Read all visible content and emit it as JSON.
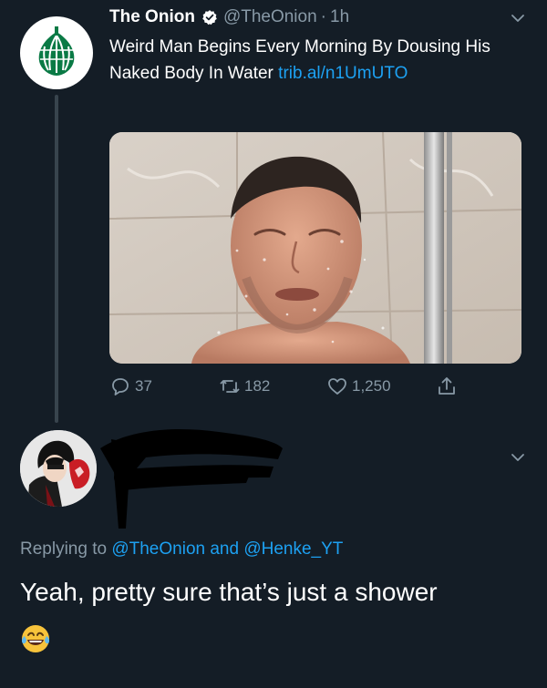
{
  "tweet": {
    "author_name": "The Onion",
    "author_handle": "@TheOnion",
    "separator": "·",
    "time": "1h",
    "text": "Weird Man Begins Every Morning By Dousing His Naked Body In Water ",
    "link": "trib.al/n1UmUTO",
    "avatar_icon": "onion-logo-icon",
    "media_description": "man-in-shower-photo",
    "actions": {
      "replies": "37",
      "retweets": "182",
      "likes": "1,250"
    }
  },
  "reply": {
    "replying_prefix": "Replying to ",
    "mention_1": "@TheOnion",
    "and": " and ",
    "mention_2": "@Henke_YT",
    "text": "Yeah, pretty sure that’s just a shower",
    "emoji": "face-with-tears-of-joy-icon"
  },
  "colors": {
    "background": "#141d26",
    "text": "#ffffff",
    "muted": "#8899a6",
    "link": "#1da1f2",
    "onion_green": "#006b3c"
  }
}
